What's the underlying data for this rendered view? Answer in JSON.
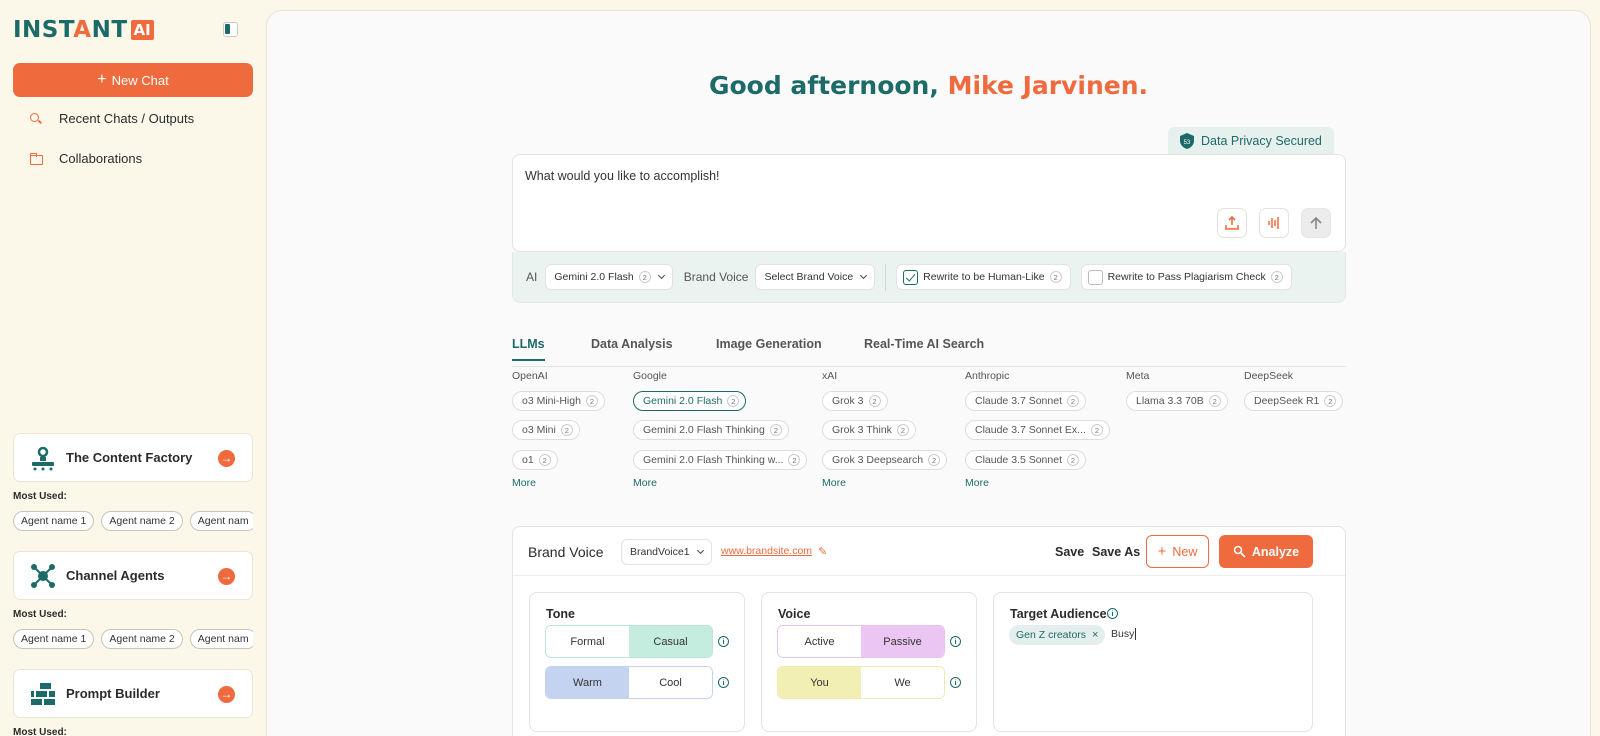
{
  "brand": {
    "word_pre": "INST",
    "word_a": "A",
    "word_post": "NT",
    "badge": "AI"
  },
  "sidebar": {
    "new_chat": "New Chat",
    "links": [
      {
        "label": "Recent Chats / Outputs",
        "icon": "search-icon"
      },
      {
        "label": "Collaborations",
        "icon": "folder-icon"
      }
    ],
    "most_used_label": "Most Used:",
    "agents": [
      {
        "title": "The Content Factory",
        "icon": "content-factory-icon",
        "chips": [
          "Agent name 1",
          "Agent name 2",
          "Agent nam"
        ]
      },
      {
        "title": "Channel Agents",
        "icon": "channel-agents-icon",
        "chips": [
          "Agent name 1",
          "Agent name 2",
          "Agent nam"
        ]
      },
      {
        "title": "Prompt Builder",
        "icon": "prompt-builder-icon",
        "chips": []
      }
    ]
  },
  "greeting": {
    "prefix": "Good afternoon, ",
    "name": "Mike Jarvinen."
  },
  "privacy": {
    "label": "Data Privacy Secured",
    "shield_num": "53"
  },
  "prompt": {
    "placeholder": "What would you like to accomplish!"
  },
  "options": {
    "ai_label": "AI",
    "ai_value": "Gemini 2.0 Flash",
    "brand_voice_label": "Brand Voice",
    "brand_voice_value": "Select Brand Voice",
    "human_like": "Rewrite to be Human-Like",
    "plagiarism": "Rewrite to Pass Plagiarism Check",
    "help": "2"
  },
  "tabs": [
    "LLMs",
    "Data Analysis",
    "Image Generation",
    "Real-Time AI Search"
  ],
  "providers": [
    {
      "name": "OpenAI",
      "models": [
        "o3 Mini-High",
        "o3 Mini",
        "o1"
      ],
      "more": "More"
    },
    {
      "name": "Google",
      "models": [
        "Gemini 2.0 Flash",
        "Gemini 2.0 Flash Thinking",
        "Gemini 2.0 Flash Thinking w..."
      ],
      "more": "More"
    },
    {
      "name": "xAI",
      "models": [
        "Grok 3",
        "Grok 3 Think",
        "Grok 3 Deepsearch"
      ],
      "more": "More"
    },
    {
      "name": "Anthropic",
      "models": [
        "Claude 3.7 Sonnet",
        "Claude 3.7 Sonnet Ex...",
        "Claude 3.5 Sonnet"
      ],
      "more": "More"
    },
    {
      "name": "Meta",
      "models": [
        "Llama 3.3 70B"
      ]
    },
    {
      "name": "DeepSeek",
      "models": [
        "DeepSeek R1"
      ]
    }
  ],
  "model_badge": "2",
  "brand_voice": {
    "title": "Brand Voice",
    "select_value": "BrandVoice1",
    "link": "www.brandsite.com",
    "save": "Save",
    "save_as": "Save As",
    "new": "New",
    "analyze": "Analyze",
    "tone": {
      "title": "Tone",
      "row1": [
        "Formal",
        "Casual"
      ],
      "row2": [
        "Warm",
        "Cool"
      ]
    },
    "voice": {
      "title": "Voice",
      "row1": [
        "Active",
        "Passive"
      ],
      "row2": [
        "You",
        "We"
      ]
    },
    "target": {
      "title": "Target Audience",
      "chip": "Gen Z creators",
      "input": "Busy"
    }
  },
  "colors": {
    "accent": "#ef6a3d",
    "brand": "#1c6b68"
  }
}
